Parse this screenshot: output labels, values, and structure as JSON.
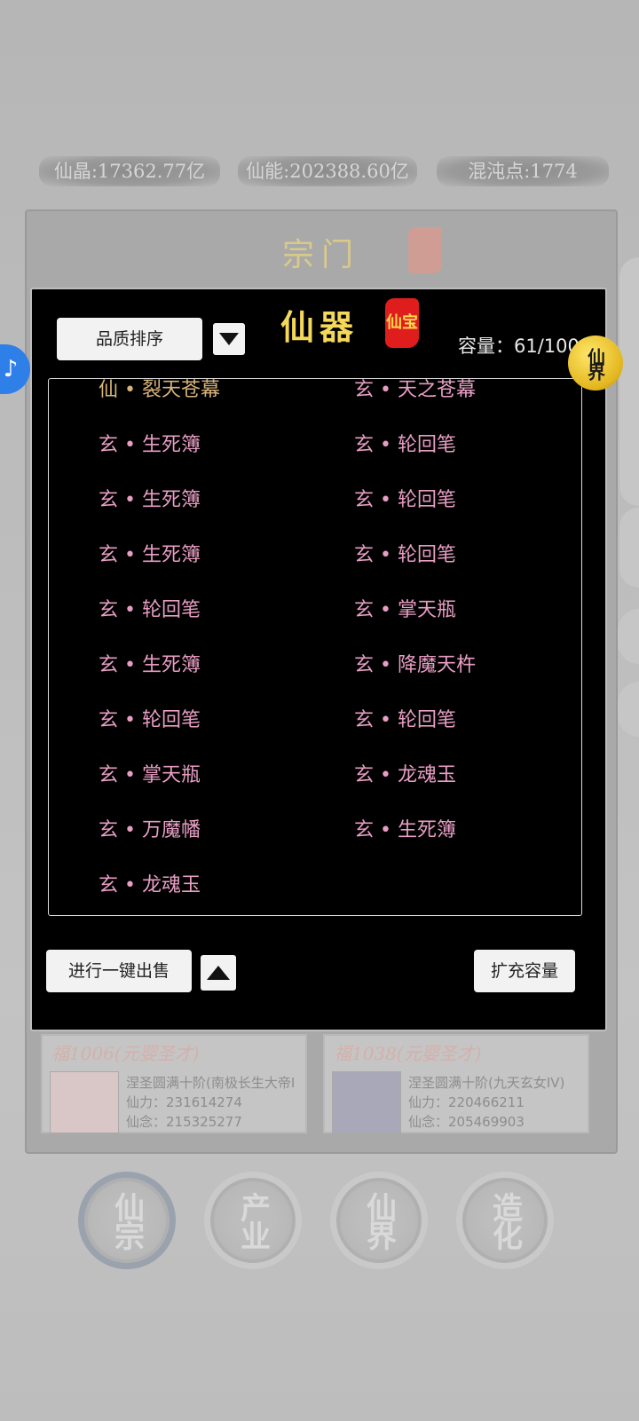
{
  "resources": {
    "spirit_crystal": "仙晶:17362.77亿",
    "immortal_power": "仙能:202388.60亿",
    "chaos_points": "混沌点:1774"
  },
  "background_panel": {
    "title": "宗门",
    "cards": [
      {
        "name": "福1006(元婴圣才)",
        "rank": "涅圣圆满十阶(南极长生大帝I",
        "power": "仙力：231614274",
        "mind": "仙念：215325277"
      },
      {
        "name": "福1038(元婴圣才)",
        "rank": "涅圣圆满十阶(九天玄女IV)",
        "power": "仙力：220466211",
        "mind": "仙念：205469903"
      }
    ]
  },
  "modal": {
    "title": "仙器",
    "seal_text": "仙宝",
    "sort_button": "品质排序",
    "capacity": "容量：61/100",
    "items": [
      "仙 • 裂天苍幕",
      "玄 • 天之苍幕",
      "玄 • 生死簿",
      "玄 • 轮回笔",
      "玄 • 生死簿",
      "玄 • 轮回笔",
      "玄 • 生死簿",
      "玄 • 轮回笔",
      "玄 • 轮回笔",
      "玄 • 掌天瓶",
      "玄 • 生死簿",
      "玄 • 降魔天杵",
      "玄 • 轮回笔",
      "玄 • 轮回笔",
      "玄 • 掌天瓶",
      "玄 • 龙魂玉",
      "玄 • 万魔幡",
      "玄 • 生死簿",
      "玄 • 龙魂玉"
    ],
    "sell_button": "进行一键出售",
    "expand_button": "扩充容量"
  },
  "badge": "仙界",
  "bottom_nav": [
    "仙宗",
    "产业",
    "仙界",
    "造化"
  ],
  "colors": {
    "item_xuan": "#e89ec4",
    "item_xian": "#d8b37a",
    "title_gold": "#f4d85a",
    "seal_red": "#e01d1d"
  }
}
